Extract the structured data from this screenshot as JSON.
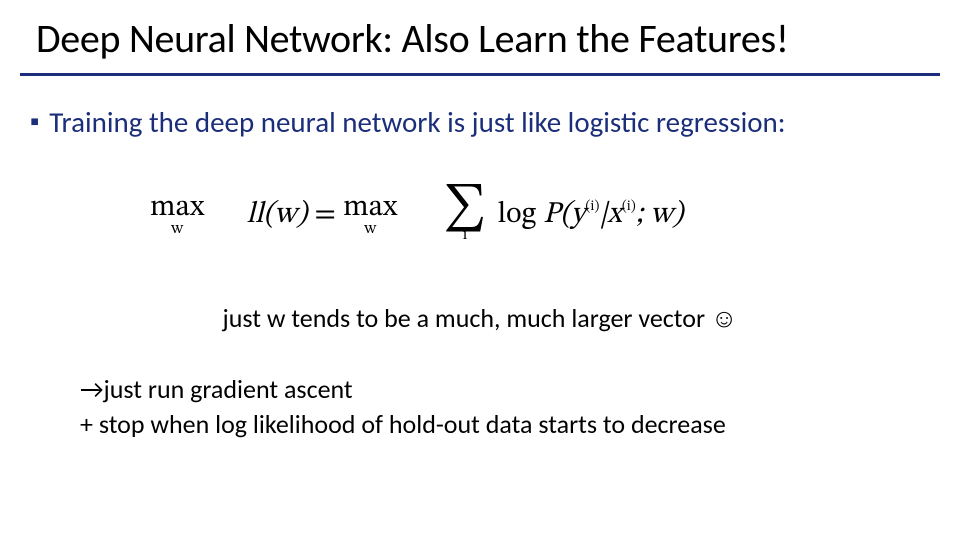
{
  "title": "Deep Neural Network: Also Learn the Features!",
  "bullet": "Training the deep neural network is just like logistic regression:",
  "equation": {
    "max1_op": "max",
    "max1_sub": "w",
    "ll": "ll(w)",
    "eq": " = ",
    "max2_op": "max",
    "max2_sub": "w",
    "sum_sub": "i",
    "log": "log ",
    "p1": "P(y",
    "sup_i1": "(i)",
    "bar": "|x",
    "sup_i2": "(i)",
    "tail": "; w)"
  },
  "note": "just w tends to be a much, much larger vector ☺",
  "tail_line1_arrow": "→",
  "tail_line1_text": "just run gradient ascent",
  "tail_line2": " + stop when log likelihood of hold-out data starts to decrease"
}
